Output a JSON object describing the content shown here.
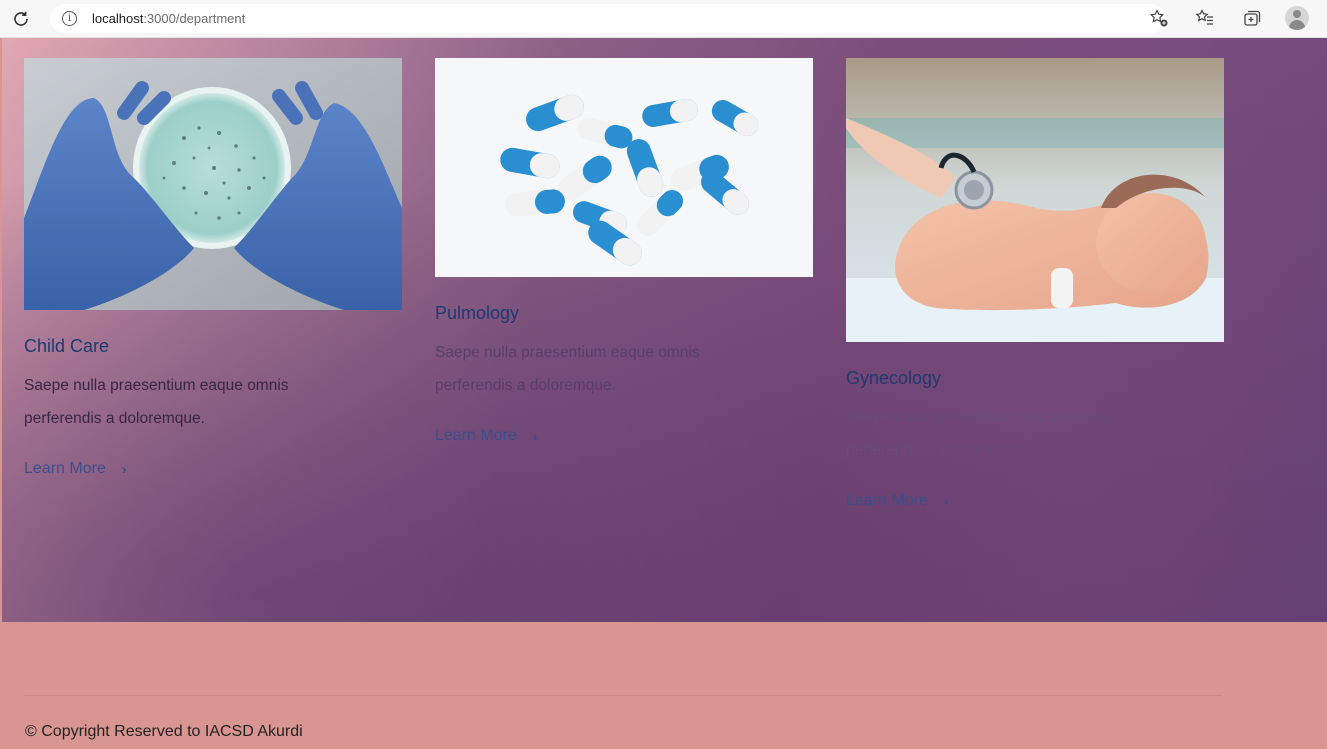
{
  "browser": {
    "url_host": "localhost",
    "url_path": ":3000/department",
    "reload_icon": "reload-icon",
    "info_icon": "info-icon"
  },
  "departments": [
    {
      "title": "Child Care",
      "description": "Saepe nulla praesentium eaque omnis perferendis a doloremque.",
      "link_label": "Learn More",
      "link_chevron": "›",
      "image": "gloved-hands-petri-dish"
    },
    {
      "title": "Pulmology",
      "description": "Saepe nulla praesentium eaque omnis perferendis a doloremque.",
      "link_label": "Learn More",
      "link_chevron": "›",
      "image": "blue-white-capsules"
    },
    {
      "title": "Gynecology",
      "description": "Saepe nulla praesentium eaque omnis perferendis a doloremque.",
      "link_label": "Learn More",
      "link_chevron": "›",
      "image": "newborn-with-stethoscope"
    }
  ],
  "footer": {
    "copyright": "© Copyright Reserved to IACSD Akurdi"
  },
  "colors": {
    "section_gradient_start": "#e2a7b3",
    "section_gradient_end": "#6f4a7c",
    "footer_bg": "#d99591",
    "title_color": "#1f3a70",
    "link_color": "#3a4f8a"
  }
}
